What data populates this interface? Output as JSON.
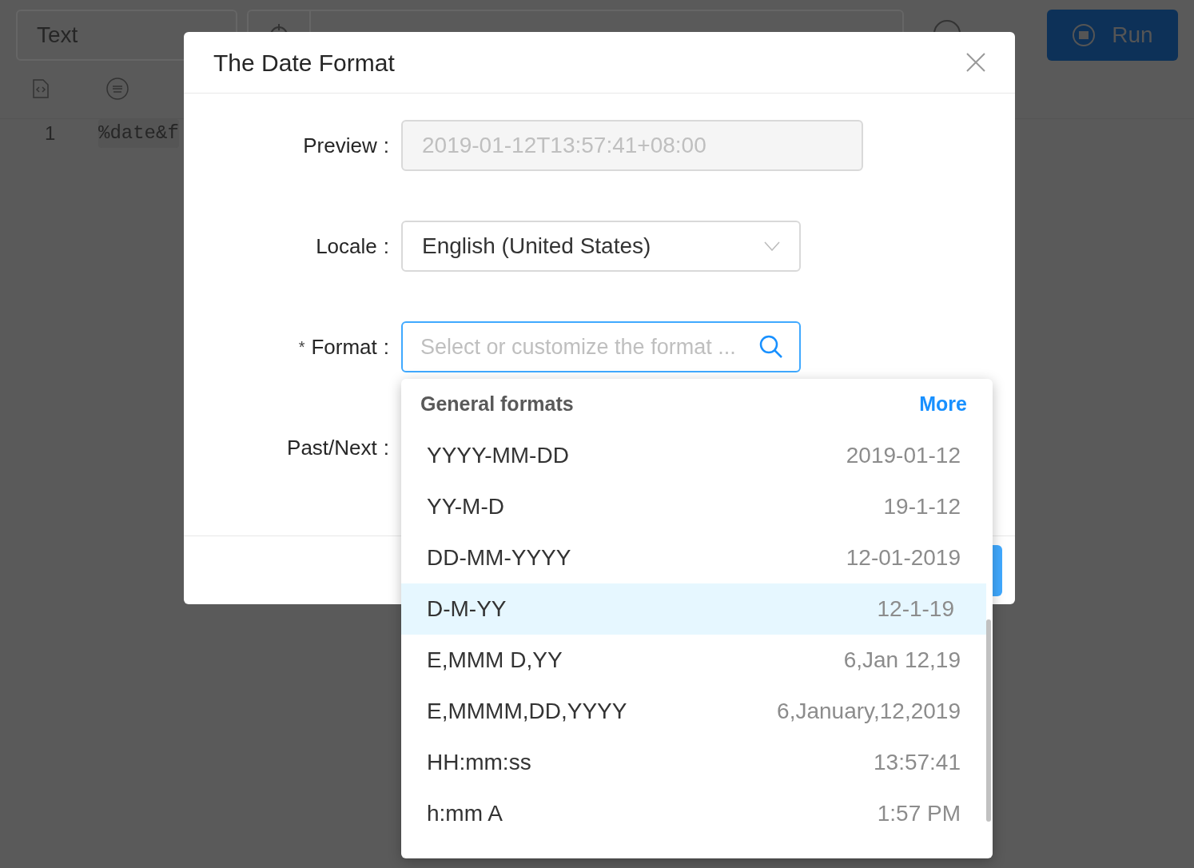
{
  "background": {
    "type_select": {
      "value": "Text"
    },
    "line_number": "1",
    "code": "%date&f",
    "run_button": {
      "label": "Run"
    }
  },
  "dialog": {
    "title": "The Date Format",
    "preview": {
      "label": "Preview",
      "value": "2019-01-12T13:57:41+08:00"
    },
    "locale": {
      "label": "Locale",
      "value": "English (United States)"
    },
    "format": {
      "label": "Format",
      "required_mark": "*",
      "placeholder": "Select or customize the format ..."
    },
    "past_next": {
      "label": "Past/Next"
    },
    "label_colon": ":"
  },
  "dropdown": {
    "heading": "General formats",
    "more": "More",
    "options": [
      {
        "format": "YYYY-MM-DD",
        "example": "2019-01-12",
        "selected": false
      },
      {
        "format": "YY-M-D",
        "example": "19-1-12",
        "selected": false
      },
      {
        "format": "DD-MM-YYYY",
        "example": "12-01-2019",
        "selected": false
      },
      {
        "format": "D-M-YY",
        "example": "12-1-19",
        "selected": true
      },
      {
        "format": "E,MMM D,YY",
        "example": "6,Jan 12,19",
        "selected": false
      },
      {
        "format": "E,MMMM,DD,YYYY",
        "example": "6,January,12,2019",
        "selected": false
      },
      {
        "format": "HH:mm:ss",
        "example": "13:57:41",
        "selected": false
      },
      {
        "format": "h:mm A",
        "example": "1:57 PM",
        "selected": false
      }
    ]
  }
}
